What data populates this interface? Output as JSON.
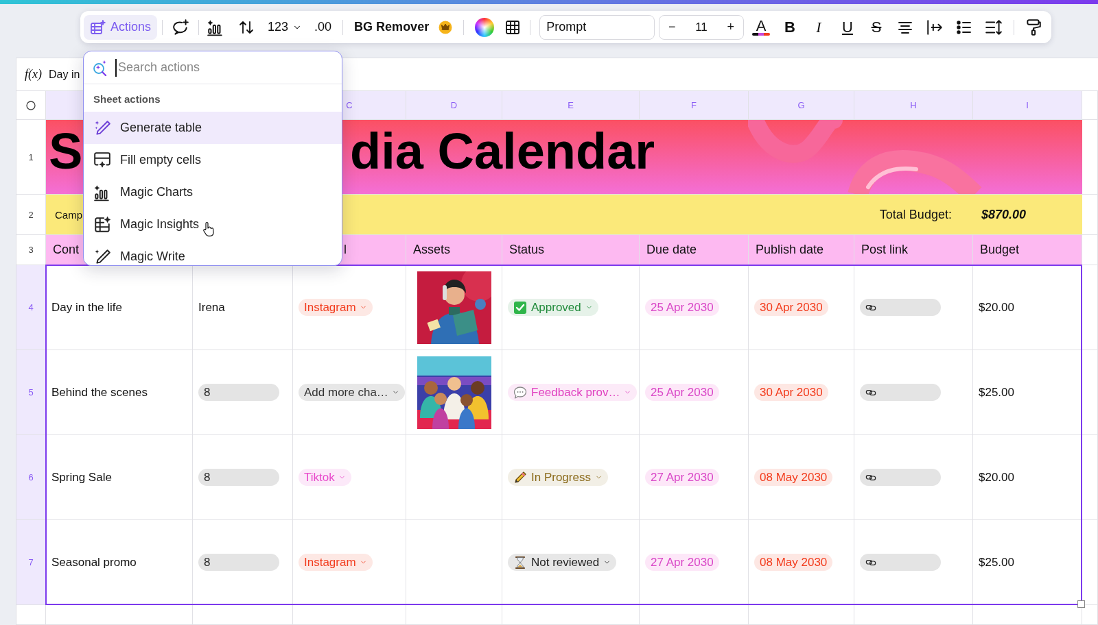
{
  "toolbar": {
    "actions": {
      "label": "Actions",
      "selected": true
    },
    "number_format": "123",
    "decimals": ".00",
    "bg_remover": "BG Remover",
    "font_field": {
      "value": "Prompt"
    },
    "font_size": {
      "decrease": "−",
      "value": "11",
      "increase": "+"
    },
    "text_color": "A",
    "format_buttons": [
      {
        "kind": "bold",
        "label": "B"
      },
      {
        "kind": "italic",
        "label": "I"
      },
      {
        "kind": "underline",
        "label": "U"
      },
      {
        "kind": "strikethrough",
        "label": "S"
      }
    ]
  },
  "actions_menu": {
    "search": {
      "placeholder": "Search actions"
    },
    "section_title": "Sheet actions",
    "items": [
      {
        "kind": "generate",
        "label": "Generate table",
        "selected": true
      },
      {
        "kind": "fill",
        "label": "Fill empty cells",
        "selected": false
      },
      {
        "kind": "charts",
        "label": "Magic Charts",
        "selected": false
      },
      {
        "kind": "insights",
        "label": "Magic Insights",
        "selected": false
      },
      {
        "kind": "write",
        "label": "Magic Write",
        "selected": false
      }
    ]
  },
  "formula_bar": {
    "label": "f(x)",
    "value": "Day in"
  },
  "sheet": {
    "column_letters": {
      "c": "C",
      "d": "D",
      "e": "E",
      "f": "F",
      "g": "G",
      "h": "H",
      "i": "I"
    },
    "row_headers": [
      {
        "number": "1",
        "selected": false
      },
      {
        "number": "2",
        "selected": false
      },
      {
        "number": "3",
        "selected": false
      }
    ],
    "banner": {
      "title_parts": [
        "S",
        "dia Calendar"
      ]
    },
    "summary_row": {
      "label": "Camp",
      "total_label": "Total Budget:",
      "total_value": "$870.00"
    },
    "header_row": {
      "a": "Cont",
      "c": "l",
      "d": "Assets",
      "e": "Status",
      "f": "Due date",
      "g": "Publish date",
      "h": "Post link",
      "i": "Budget"
    },
    "rows": [
      {
        "number": "4",
        "selected": true,
        "content": "Day in the life",
        "owner": {
          "kind": "text",
          "text": "Irena"
        },
        "channel": {
          "text": "Instagram",
          "color": "#f23c1e"
        },
        "status": {
          "kind": "approved",
          "text": "Approved",
          "color": "#1f8a3a"
        },
        "due_date": "25 Apr 2030",
        "publish_date": "30 Apr 2030",
        "budget": "$20.00"
      },
      {
        "number": "5",
        "selected": true,
        "content": "Behind the scenes",
        "owner": {
          "kind": "tag",
          "text": "8"
        },
        "channel": {
          "text": "Add more cha…",
          "color": "#333333"
        },
        "status": {
          "kind": "feedback",
          "text": "Feedback prov…",
          "color": "#e040c0"
        },
        "due_date": "25 Apr 2030",
        "publish_date": "30 Apr 2030",
        "budget": "$25.00"
      },
      {
        "number": "6",
        "selected": true,
        "content": "Spring Sale",
        "owner": {
          "kind": "tag",
          "text": "8"
        },
        "channel": {
          "text": "Tiktok",
          "color": "#e84acb"
        },
        "status": {
          "kind": "in_progress",
          "text": "In Progress",
          "color": "#8a6a1a"
        },
        "due_date": "27 Apr 2030",
        "publish_date": "08 May 2030",
        "budget": "$20.00"
      },
      {
        "number": "7",
        "selected": true,
        "content": "Seasonal promo",
        "owner": {
          "kind": "tag",
          "text": "8"
        },
        "channel": {
          "text": "Instagram",
          "color": "#f23c1e"
        },
        "status": {
          "kind": "not_reviewed",
          "text": "Not reviewed",
          "color": "#222222"
        },
        "due_date": "27 Apr 2030",
        "publish_date": "08 May 2030",
        "budget": "$25.00"
      }
    ]
  }
}
